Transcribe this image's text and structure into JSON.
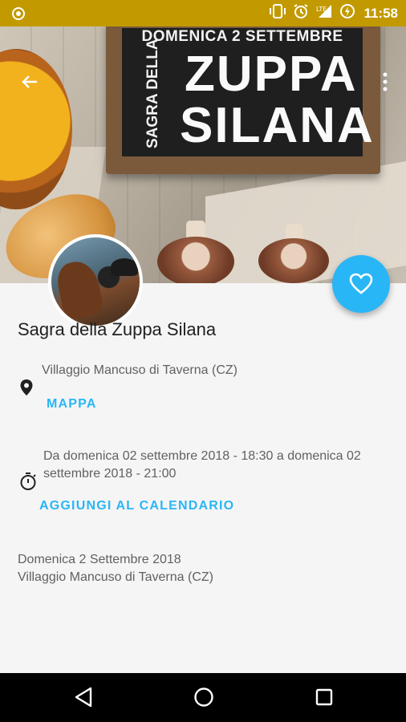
{
  "status_bar": {
    "time": "11:58",
    "network": "LTE"
  },
  "hero": {
    "board_top": "DOMENICA 2 SETTEMBRE",
    "board_side": "SAGRA DELLA",
    "board_line1": "ZUPPA",
    "board_line2": "SILANA"
  },
  "event": {
    "title": "Sagra della Zuppa Silana",
    "location": "Villaggio Mancuso di Taverna (CZ)",
    "map_label": "MAPPA",
    "date_range": "Da domenica 02 settembre 2018 - 18:30 a domenica 02 settembre 2018 - 21:00",
    "calendar_label": "AGGIUNGI AL CALENDARIO",
    "description_line1": "Domenica 2 Settembre 2018",
    "description_line2": "Villaggio Mancuso di Taverna (CZ)"
  },
  "colors": {
    "status_bar": "#c29a00",
    "accent": "#29b6f6",
    "fab": "#29b6f6"
  },
  "icons": [
    "back-arrow-icon",
    "more-vert-icon",
    "heart-outline-icon",
    "location-pin-icon",
    "timer-icon",
    "nav-back-icon",
    "nav-home-icon",
    "nav-recents-icon"
  ]
}
